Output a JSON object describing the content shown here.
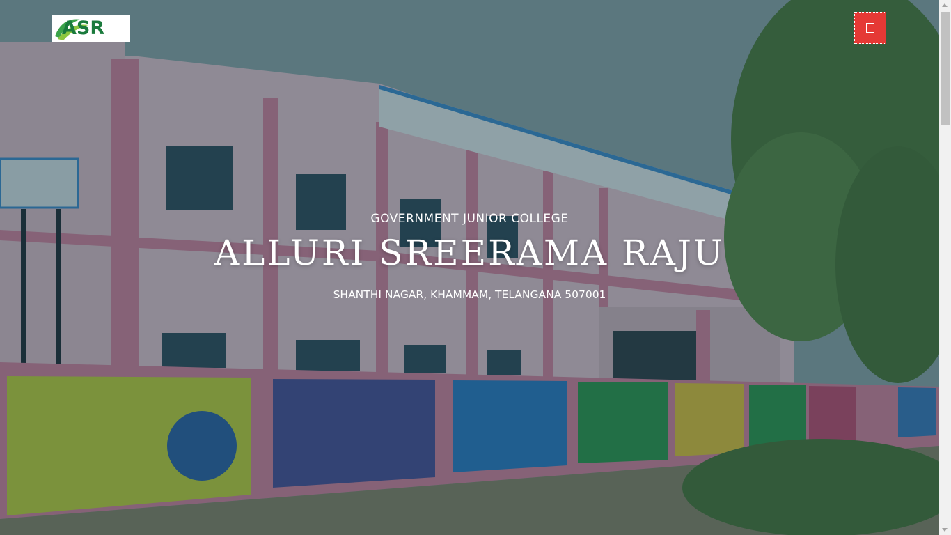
{
  "header": {
    "logo_text": "ASR",
    "menu_button_icon": "menu-icon"
  },
  "hero": {
    "subtitle": "GOVERNMENT JUNIOR COLLEGE",
    "title": "ALLURI SREERAMA RAJU",
    "address": "SHANTHI NAGAR, KHAMMAM, TELANGANA 507001",
    "background_image": "college-building-photo"
  },
  "colors": {
    "menu_button_bg": "#e53935",
    "overlay": "#123440",
    "logo_green": "#1a7a3c",
    "text": "#ffffff"
  }
}
